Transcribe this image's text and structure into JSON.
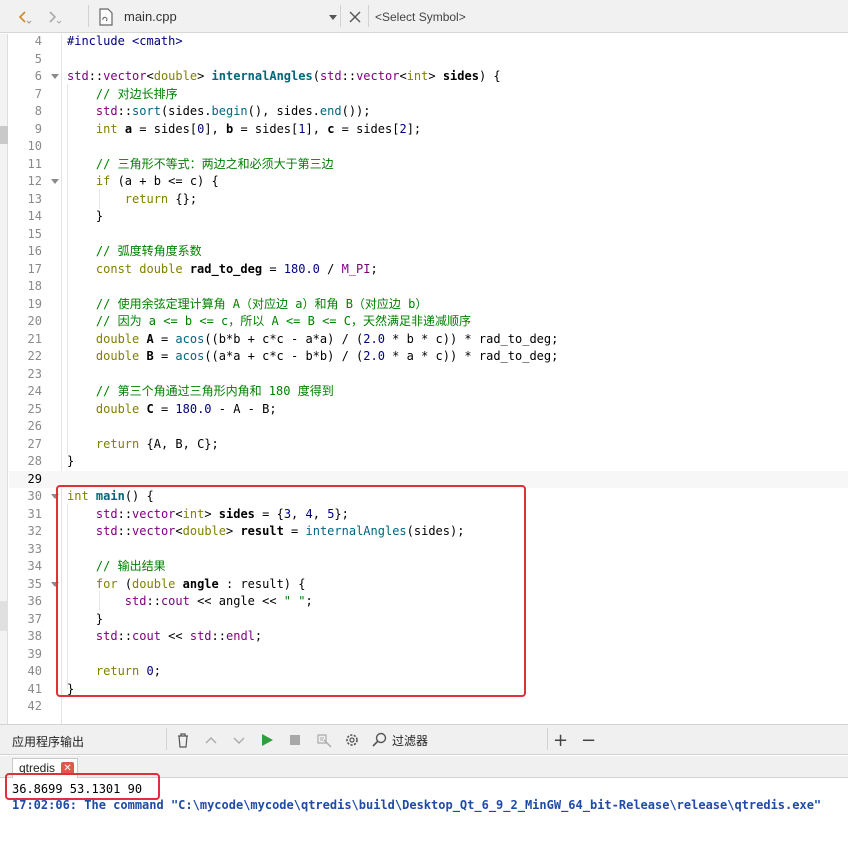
{
  "toolbar": {
    "back_icon": "chevron-left-icon",
    "forward_icon": "chevron-right-icon",
    "file_icon": "document-icon",
    "file_name": "main.cpp",
    "close_icon": "close-icon",
    "symbol_placeholder": "<Select Symbol>"
  },
  "editor": {
    "current_line": "29",
    "lines": [
      {
        "n": "4",
        "fold": false
      },
      {
        "n": "5",
        "fold": false
      },
      {
        "n": "6",
        "fold": true
      },
      {
        "n": "7",
        "fold": false
      },
      {
        "n": "8",
        "fold": false
      },
      {
        "n": "9",
        "fold": false
      },
      {
        "n": "10",
        "fold": false
      },
      {
        "n": "11",
        "fold": false
      },
      {
        "n": "12",
        "fold": true
      },
      {
        "n": "13",
        "fold": false
      },
      {
        "n": "14",
        "fold": false
      },
      {
        "n": "15",
        "fold": false
      },
      {
        "n": "16",
        "fold": false
      },
      {
        "n": "17",
        "fold": false
      },
      {
        "n": "18",
        "fold": false
      },
      {
        "n": "19",
        "fold": false
      },
      {
        "n": "20",
        "fold": false
      },
      {
        "n": "21",
        "fold": false
      },
      {
        "n": "22",
        "fold": false
      },
      {
        "n": "23",
        "fold": false
      },
      {
        "n": "24",
        "fold": false
      },
      {
        "n": "25",
        "fold": false
      },
      {
        "n": "26",
        "fold": false
      },
      {
        "n": "27",
        "fold": false
      },
      {
        "n": "28",
        "fold": false
      },
      {
        "n": "29",
        "fold": false
      },
      {
        "n": "30",
        "fold": true
      },
      {
        "n": "31",
        "fold": false
      },
      {
        "n": "32",
        "fold": false
      },
      {
        "n": "33",
        "fold": false
      },
      {
        "n": "34",
        "fold": false
      },
      {
        "n": "35",
        "fold": true
      },
      {
        "n": "36",
        "fold": false
      },
      {
        "n": "37",
        "fold": false
      },
      {
        "n": "38",
        "fold": false
      },
      {
        "n": "39",
        "fold": false
      },
      {
        "n": "40",
        "fold": false
      },
      {
        "n": "41",
        "fold": false
      },
      {
        "n": "42",
        "fold": false
      }
    ],
    "code": [
      [
        [
          "pp",
          "#include <cmath>"
        ]
      ],
      [],
      [
        [
          "ty",
          "std"
        ],
        [
          "",
          "::"
        ],
        [
          "ty",
          "vector"
        ],
        [
          "",
          "<"
        ],
        [
          "kw",
          "double"
        ],
        [
          "",
          "> "
        ],
        [
          "fnb",
          "internalAngles"
        ],
        [
          "",
          "("
        ],
        [
          "ty",
          "std"
        ],
        [
          "",
          "::"
        ],
        [
          "ty",
          "vector"
        ],
        [
          "",
          "<"
        ],
        [
          "kw",
          "int"
        ],
        [
          "",
          "> "
        ],
        [
          "bold",
          "sides"
        ],
        [
          "",
          ") {"
        ]
      ],
      [
        [
          "",
          "    "
        ],
        [
          "cm",
          "// 对边长排序"
        ]
      ],
      [
        [
          "",
          "    "
        ],
        [
          "ty",
          "std"
        ],
        [
          "",
          "::"
        ],
        [
          "fn",
          "sort"
        ],
        [
          "",
          "(sides."
        ],
        [
          "fn",
          "begin"
        ],
        [
          "",
          "(), sides."
        ],
        [
          "fn",
          "end"
        ],
        [
          "",
          "());"
        ]
      ],
      [
        [
          "",
          "    "
        ],
        [
          "kw",
          "int"
        ],
        [
          "bold",
          " a"
        ],
        [
          "",
          " = sides["
        ],
        [
          "nm",
          "0"
        ],
        [
          "",
          "], "
        ],
        [
          "bold",
          "b"
        ],
        [
          "",
          " = sides["
        ],
        [
          "nm",
          "1"
        ],
        [
          "",
          "], "
        ],
        [
          "bold",
          "c"
        ],
        [
          "",
          " = sides["
        ],
        [
          "nm",
          "2"
        ],
        [
          "",
          "];"
        ]
      ],
      [],
      [
        [
          "",
          "    "
        ],
        [
          "cm",
          "// 三角形不等式：两边之和必须大于第三边"
        ]
      ],
      [
        [
          "",
          "    "
        ],
        [
          "kw",
          "if"
        ],
        [
          "",
          " (a + b <= c) {"
        ]
      ],
      [
        [
          "",
          "        "
        ],
        [
          "kw",
          "return"
        ],
        [
          "",
          " {};"
        ]
      ],
      [
        [
          "",
          "    }"
        ]
      ],
      [],
      [
        [
          "",
          "    "
        ],
        [
          "cm",
          "// 弧度转角度系数"
        ]
      ],
      [
        [
          "",
          "    "
        ],
        [
          "kw",
          "const double"
        ],
        [
          "bold",
          " rad_to_deg"
        ],
        [
          "",
          " = "
        ],
        [
          "nm",
          "180.0"
        ],
        [
          "",
          " / "
        ],
        [
          "mac",
          "M_PI"
        ],
        [
          "",
          ";"
        ]
      ],
      [],
      [
        [
          "",
          "    "
        ],
        [
          "cm",
          "// 使用余弦定理计算角 A（对应边 a）和角 B（对应边 b）"
        ]
      ],
      [
        [
          "",
          "    "
        ],
        [
          "cm",
          "// 因为 a <= b <= c，所以 A <= B <= C，天然满足非递减顺序"
        ]
      ],
      [
        [
          "",
          "    "
        ],
        [
          "kw",
          "double"
        ],
        [
          "bold",
          " A"
        ],
        [
          "",
          " = "
        ],
        [
          "fn",
          "acos"
        ],
        [
          "",
          "((b*b + c*c - a*a) / ("
        ],
        [
          "nm",
          "2.0"
        ],
        [
          "",
          " * b * c)) * rad_to_deg;"
        ]
      ],
      [
        [
          "",
          "    "
        ],
        [
          "kw",
          "double"
        ],
        [
          "bold",
          " B"
        ],
        [
          "",
          " = "
        ],
        [
          "fn",
          "acos"
        ],
        [
          "",
          "((a*a + c*c - b*b) / ("
        ],
        [
          "nm",
          "2.0"
        ],
        [
          "",
          " * a * c)) * rad_to_deg;"
        ]
      ],
      [],
      [
        [
          "",
          "    "
        ],
        [
          "cm",
          "// 第三个角通过三角形内角和 180 度得到"
        ]
      ],
      [
        [
          "",
          "    "
        ],
        [
          "kw",
          "double"
        ],
        [
          "bold",
          " C"
        ],
        [
          "",
          " = "
        ],
        [
          "nm",
          "180.0"
        ],
        [
          "",
          " - A - B;"
        ]
      ],
      [],
      [
        [
          "",
          "    "
        ],
        [
          "kw",
          "return"
        ],
        [
          "",
          " {A, B, C};"
        ]
      ],
      [
        [
          "",
          "}"
        ]
      ],
      [],
      [
        [
          "kw",
          "int"
        ],
        [
          "",
          " "
        ],
        [
          "fnb",
          "main"
        ],
        [
          "",
          "() {"
        ]
      ],
      [
        [
          "",
          "    "
        ],
        [
          "ty",
          "std"
        ],
        [
          "",
          "::"
        ],
        [
          "ty",
          "vector"
        ],
        [
          "",
          "<"
        ],
        [
          "kw",
          "int"
        ],
        [
          "",
          "> "
        ],
        [
          "bold",
          "sides"
        ],
        [
          "",
          " = {"
        ],
        [
          "nm",
          "3"
        ],
        [
          "",
          ", "
        ],
        [
          "nm",
          "4"
        ],
        [
          "",
          ", "
        ],
        [
          "nm",
          "5"
        ],
        [
          "",
          "};"
        ]
      ],
      [
        [
          "",
          "    "
        ],
        [
          "ty",
          "std"
        ],
        [
          "",
          "::"
        ],
        [
          "ty",
          "vector"
        ],
        [
          "",
          "<"
        ],
        [
          "kw",
          "double"
        ],
        [
          "",
          "> "
        ],
        [
          "bold",
          "result"
        ],
        [
          "",
          " = "
        ],
        [
          "fn",
          "internalAngles"
        ],
        [
          "",
          "(sides);"
        ]
      ],
      [],
      [
        [
          "",
          "    "
        ],
        [
          "cm",
          "// 输出结果"
        ]
      ],
      [
        [
          "",
          "    "
        ],
        [
          "kw",
          "for"
        ],
        [
          "",
          " ("
        ],
        [
          "kw",
          "double"
        ],
        [
          "bold",
          " angle"
        ],
        [
          "",
          " : result) {"
        ]
      ],
      [
        [
          "",
          "        "
        ],
        [
          "ty",
          "std"
        ],
        [
          "",
          "::"
        ],
        [
          "ty",
          "cout"
        ],
        [
          "",
          " << angle << "
        ],
        [
          "st",
          "\" \""
        ],
        [
          "",
          ";"
        ]
      ],
      [
        [
          "",
          "    }"
        ]
      ],
      [
        [
          "",
          "    "
        ],
        [
          "ty",
          "std"
        ],
        [
          "",
          "::"
        ],
        [
          "ty",
          "cout"
        ],
        [
          "",
          " << "
        ],
        [
          "ty",
          "std"
        ],
        [
          "",
          "::"
        ],
        [
          "ty",
          "endl"
        ],
        [
          "",
          ";"
        ]
      ],
      [],
      [
        [
          "",
          "    "
        ],
        [
          "kw",
          "return"
        ],
        [
          "",
          " "
        ],
        [
          "nm",
          "0"
        ],
        [
          "",
          ";"
        ]
      ],
      [
        [
          "",
          "}"
        ]
      ],
      []
    ]
  },
  "output_pane": {
    "title": "应用程序输出",
    "icons": [
      "trash-icon",
      "arrow-up-icon",
      "arrow-down-icon",
      "run-icon",
      "stop-icon",
      "debug-icon",
      "settings-icon"
    ],
    "filter_label": "过滤器",
    "plus_label": "+",
    "minus_label": "−",
    "tab_label": "qtredis",
    "result_line": "36.8699 53.1301 90",
    "command_line": "17:02:06: The command \"C:\\mycode\\mycode\\qtredis\\build\\Desktop_Qt_6_9_2_MinGW_64_bit-Release\\release\\qtredis.exe\""
  },
  "colors": {
    "highlight_box": "#e0303a",
    "run_green": "#2e9e3e",
    "keyword": "#808000",
    "type": "#800080",
    "comment": "#008000",
    "number": "#000080"
  }
}
